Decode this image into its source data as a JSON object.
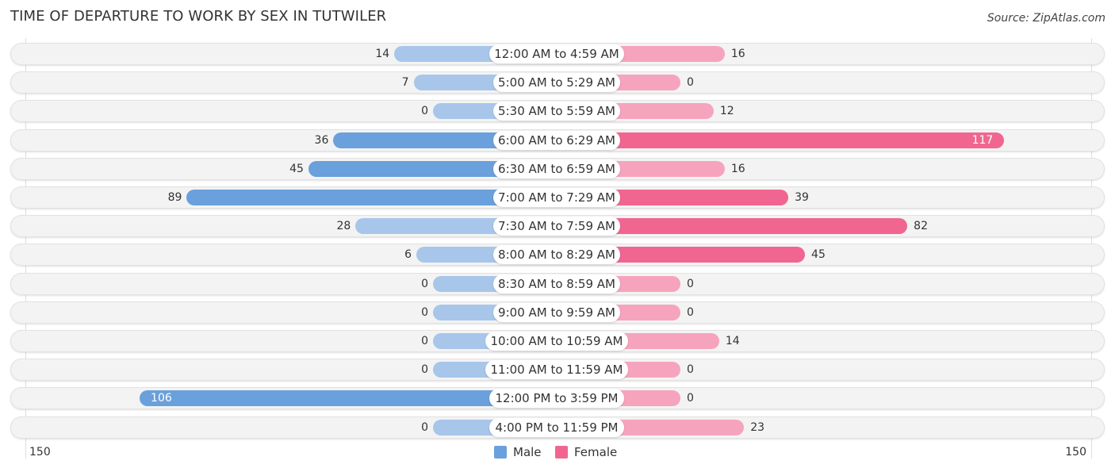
{
  "chart_data": {
    "type": "bar",
    "orientation": "horizontal-diverging",
    "title": "TIME OF DEPARTURE TO WORK BY SEX IN TUTWILER",
    "source": "Source: ZipAtlas.com",
    "categories": [
      "12:00 AM to 4:59 AM",
      "5:00 AM to 5:29 AM",
      "5:30 AM to 5:59 AM",
      "6:00 AM to 6:29 AM",
      "6:30 AM to 6:59 AM",
      "7:00 AM to 7:29 AM",
      "7:30 AM to 7:59 AM",
      "8:00 AM to 8:29 AM",
      "8:30 AM to 8:59 AM",
      "9:00 AM to 9:59 AM",
      "10:00 AM to 10:59 AM",
      "11:00 AM to 11:59 AM",
      "12:00 PM to 3:59 PM",
      "4:00 PM to 11:59 PM"
    ],
    "series": [
      {
        "name": "Male",
        "color": "#6aa0db",
        "values": [
          14,
          7,
          0,
          36,
          45,
          89,
          28,
          6,
          0,
          0,
          0,
          0,
          106,
          0
        ]
      },
      {
        "name": "Female",
        "color": "#f06690",
        "values": [
          16,
          0,
          12,
          117,
          16,
          39,
          82,
          45,
          0,
          0,
          14,
          0,
          0,
          23
        ]
      }
    ],
    "axis": {
      "left_label": "150",
      "right_label": "150",
      "max": 150
    },
    "legend": {
      "position": "bottom-center",
      "items": [
        "Male",
        "Female"
      ]
    }
  }
}
